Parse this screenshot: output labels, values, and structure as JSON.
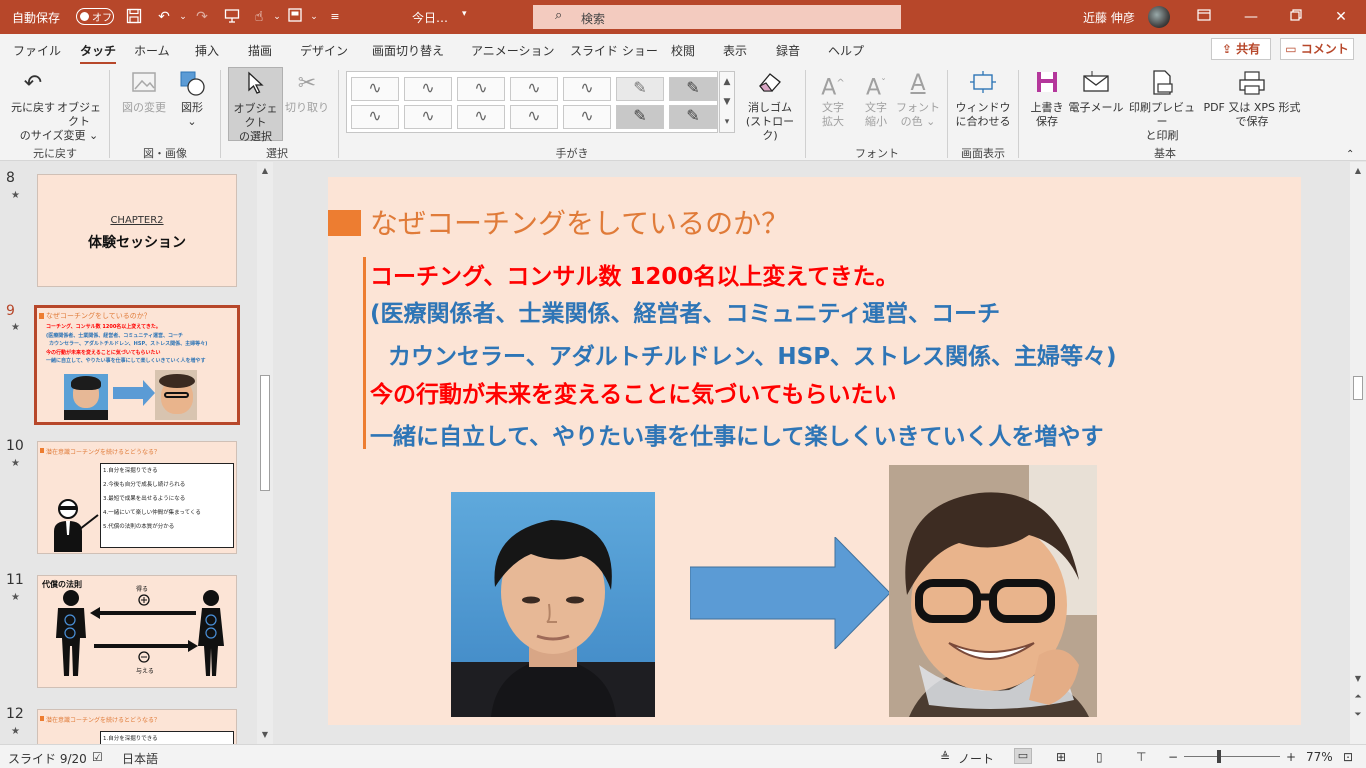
{
  "titlebar": {
    "autosave_label": "自動保存",
    "autosave_state": "オフ",
    "doc_title": "今日…",
    "doc_title_more": "▾",
    "search_placeholder": "検索",
    "user_name": "近藤 伸彦",
    "accent_color": "#b7472a"
  },
  "menu": {
    "tabs": [
      "ファイル",
      "タッチ",
      "ホーム",
      "挿入",
      "描画",
      "デザイン",
      "画面切り替え",
      "アニメーション",
      "スライド ショー",
      "校閲",
      "表示",
      "録音",
      "ヘルプ"
    ],
    "active_tab": "タッチ",
    "share_label": "共有",
    "comment_label": "コメント"
  },
  "ribbon": {
    "undo": {
      "label1": "元に戻す",
      "label2": "",
      "group": "元に戻す"
    },
    "resize": {
      "label1": "オブジェクト",
      "label2": "のサイズ変更 ⌄"
    },
    "change_image": {
      "label1": "図の変更"
    },
    "shapes": {
      "label1": "図形",
      "label2": "⌄"
    },
    "group_image": "図・画像",
    "select_object": {
      "label1": "オブジェクト",
      "label2": "の選択"
    },
    "cut": {
      "label1": "切り取り"
    },
    "group_select": "選択",
    "group_handwriting": "手がき",
    "eraser": {
      "label1": "消しゴム",
      "label2": "(ストローク)"
    },
    "font_grow": {
      "label1": "文字",
      "label2": "拡大"
    },
    "font_shrink": {
      "label1": "文字",
      "label2": "縮小"
    },
    "font_color": {
      "label1": "フォント",
      "label2": "の色 ⌄"
    },
    "group_font": "フォント",
    "fit_window": {
      "label1": "ウィンドウ",
      "label2": "に合わせる"
    },
    "group_view": "画面表示",
    "save": {
      "label1": "上書き",
      "label2": "保存"
    },
    "email": {
      "label1": "電子メール"
    },
    "print_preview": {
      "label1": "印刷プレビュー",
      "label2": "と印刷"
    },
    "pdf": {
      "label1": "PDF 又は XPS 形式",
      "label2": "で保存"
    },
    "group_basic": "基本"
  },
  "thumbnails": [
    {
      "num": "8",
      "star": "★",
      "chapter": "CHAPTER2",
      "title": "体験セッション"
    },
    {
      "num": "9",
      "star": "★",
      "title": "なぜコーチングをしているのか？",
      "lines": [
        "コーチング、コンサル数 1200名以上変えてきた。",
        "(医療関係者、士業関係、経営者、コミュニティ運営、コーチ",
        "カウンセラー、アダルトチルドレン、HSP、ストレス関係、主婦等々)",
        "今の行動が未来を変えることに気づいてもらいたい",
        "一緒に自立して、やりたい事を仕事にして楽しくいきていく人を増やす"
      ]
    },
    {
      "num": "10",
      "star": "★",
      "title": "潜在意識コーチングを続けるとどうなる？",
      "items": [
        "1.自分を深掘りできる",
        "2.今後も自分で成長し続けられる",
        "3.最短で成果を出せるようになる",
        "4.一緒にいて楽しい仲間が集まってくる",
        "5.代償の法則の本質が分かる"
      ]
    },
    {
      "num": "11",
      "star": "★",
      "title": "代償の法則",
      "top_label": "得る",
      "bottom_label": "与える"
    },
    {
      "num": "12",
      "star": "★",
      "title": "潜在意識コーチングを続けるとどうなる？",
      "items": [
        "1.自分を深掘りできる"
      ]
    }
  ],
  "slide": {
    "title": "なぜコーチングをしているのか？",
    "lines": [
      {
        "text": "コーチング、コンサル数 1200名以上変えてきた。",
        "color": "red"
      },
      {
        "text": "(医療関係者、士業関係、経営者、コミュニティ運営、コーチ",
        "color": "blue"
      },
      {
        "text": "カウンセラー、アダルトチルドレン、HSP、ストレス関係、主婦等々)",
        "color": "blue"
      },
      {
        "text": "今の行動が未来を変えることに気づいてもらいたい",
        "color": "red"
      },
      {
        "text": "一緒に自立して、やりたい事を仕事にして楽しくいきていく人を増やす",
        "color": "blue"
      }
    ],
    "arrow_color": "#5b9bd5"
  },
  "status": {
    "slide_info": "スライド 9/20",
    "language": "日本語",
    "notes_label": "ノート",
    "zoom": "77%"
  }
}
